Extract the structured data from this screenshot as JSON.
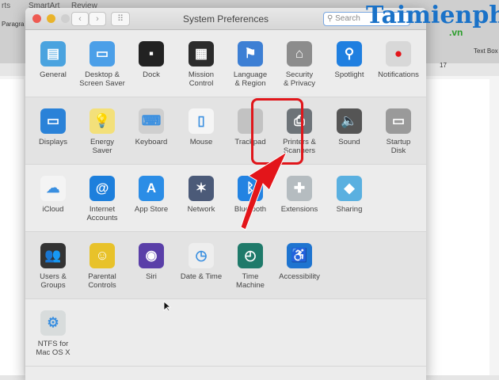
{
  "background": {
    "tabs": [
      "rts",
      "SmartArt",
      "Review"
    ],
    "paragraph_label": "Paragra",
    "textbox_label": "Text Box",
    "ruler_number": "17"
  },
  "watermark": {
    "brand": "Taimienphi",
    "suffix": ".vn"
  },
  "window": {
    "title": "System Preferences",
    "search_placeholder": "Search",
    "back": "‹",
    "forward": "›",
    "grid": "⠿"
  },
  "rows": [
    [
      {
        "n": "general",
        "l": "General",
        "c": "#4aa3df",
        "g": "▤"
      },
      {
        "n": "desktop-screen-saver",
        "l": "Desktop &\nScreen Saver",
        "c": "#4b9fe8",
        "g": "▭"
      },
      {
        "n": "dock",
        "l": "Dock",
        "c": "#222",
        "g": "▪"
      },
      {
        "n": "mission-control",
        "l": "Mission\nControl",
        "c": "#2b2b2b",
        "g": "▦"
      },
      {
        "n": "language-region",
        "l": "Language\n& Region",
        "c": "#3d7fd4",
        "g": "⚑"
      },
      {
        "n": "security-privacy",
        "l": "Security\n& Privacy",
        "c": "#8c8c8c",
        "g": "⌂"
      },
      {
        "n": "spotlight",
        "l": "Spotlight",
        "c": "#1f7fe0",
        "g": "⚲"
      },
      {
        "n": "notifications",
        "l": "Notifications",
        "c": "#d8d8d8",
        "g": "●"
      }
    ],
    [
      {
        "n": "displays",
        "l": "Displays",
        "c": "#2a82d8",
        "g": "▭"
      },
      {
        "n": "energy-saver",
        "l": "Energy\nSaver",
        "c": "#f3e07a",
        "g": "💡"
      },
      {
        "n": "keyboard",
        "l": "Keyboard",
        "c": "#cfcfcf",
        "g": "⌨"
      },
      {
        "n": "mouse",
        "l": "Mouse",
        "c": "#f5f5f5",
        "g": "▯"
      },
      {
        "n": "trackpad",
        "l": "Trackpad",
        "c": "#c2c2c2",
        "g": ""
      },
      {
        "n": "printers-scanners",
        "l": "Printers &\nScanners",
        "c": "#6d7378",
        "g": "⎙"
      },
      {
        "n": "sound",
        "l": "Sound",
        "c": "#555",
        "g": "🔈"
      },
      {
        "n": "startup-disk",
        "l": "Startup\nDisk",
        "c": "#9a9a9a",
        "g": "▭"
      }
    ],
    [
      {
        "n": "icloud",
        "l": "iCloud",
        "c": "#f4f4f4",
        "g": "☁"
      },
      {
        "n": "internet-accounts",
        "l": "Internet\nAccounts",
        "c": "#1d7fdc",
        "g": "@"
      },
      {
        "n": "app-store",
        "l": "App Store",
        "c": "#2b8de6",
        "g": "A"
      },
      {
        "n": "network",
        "l": "Network",
        "c": "#4b5a78",
        "g": "✶"
      },
      {
        "n": "bluetooth",
        "l": "Bluetooth",
        "c": "#2383e2",
        "g": "ᛒ"
      },
      {
        "n": "extensions",
        "l": "Extensions",
        "c": "#b5bcc0",
        "g": "✚"
      },
      {
        "n": "sharing",
        "l": "Sharing",
        "c": "#5ab0e0",
        "g": "◆"
      }
    ],
    [
      {
        "n": "users-groups",
        "l": "Users &\nGroups",
        "c": "#333",
        "g": "👥"
      },
      {
        "n": "parental-controls",
        "l": "Parental\nControls",
        "c": "#e8c22a",
        "g": "☺"
      },
      {
        "n": "siri",
        "l": "Siri",
        "c": "#5a3fa8",
        "g": "◉"
      },
      {
        "n": "date-time",
        "l": "Date & Time",
        "c": "#eee",
        "g": "◷"
      },
      {
        "n": "time-machine",
        "l": "Time\nMachine",
        "c": "#1f7a6a",
        "g": "◴"
      },
      {
        "n": "accessibility",
        "l": "Accessibility",
        "c": "#1e74d0",
        "g": "♿"
      }
    ],
    [
      {
        "n": "ntfs-for-mac",
        "l": "NTFS for\nMac OS X",
        "c": "#d8dcdc",
        "g": "⚙"
      }
    ]
  ],
  "colors": {
    "highlight": "#e0161b"
  }
}
